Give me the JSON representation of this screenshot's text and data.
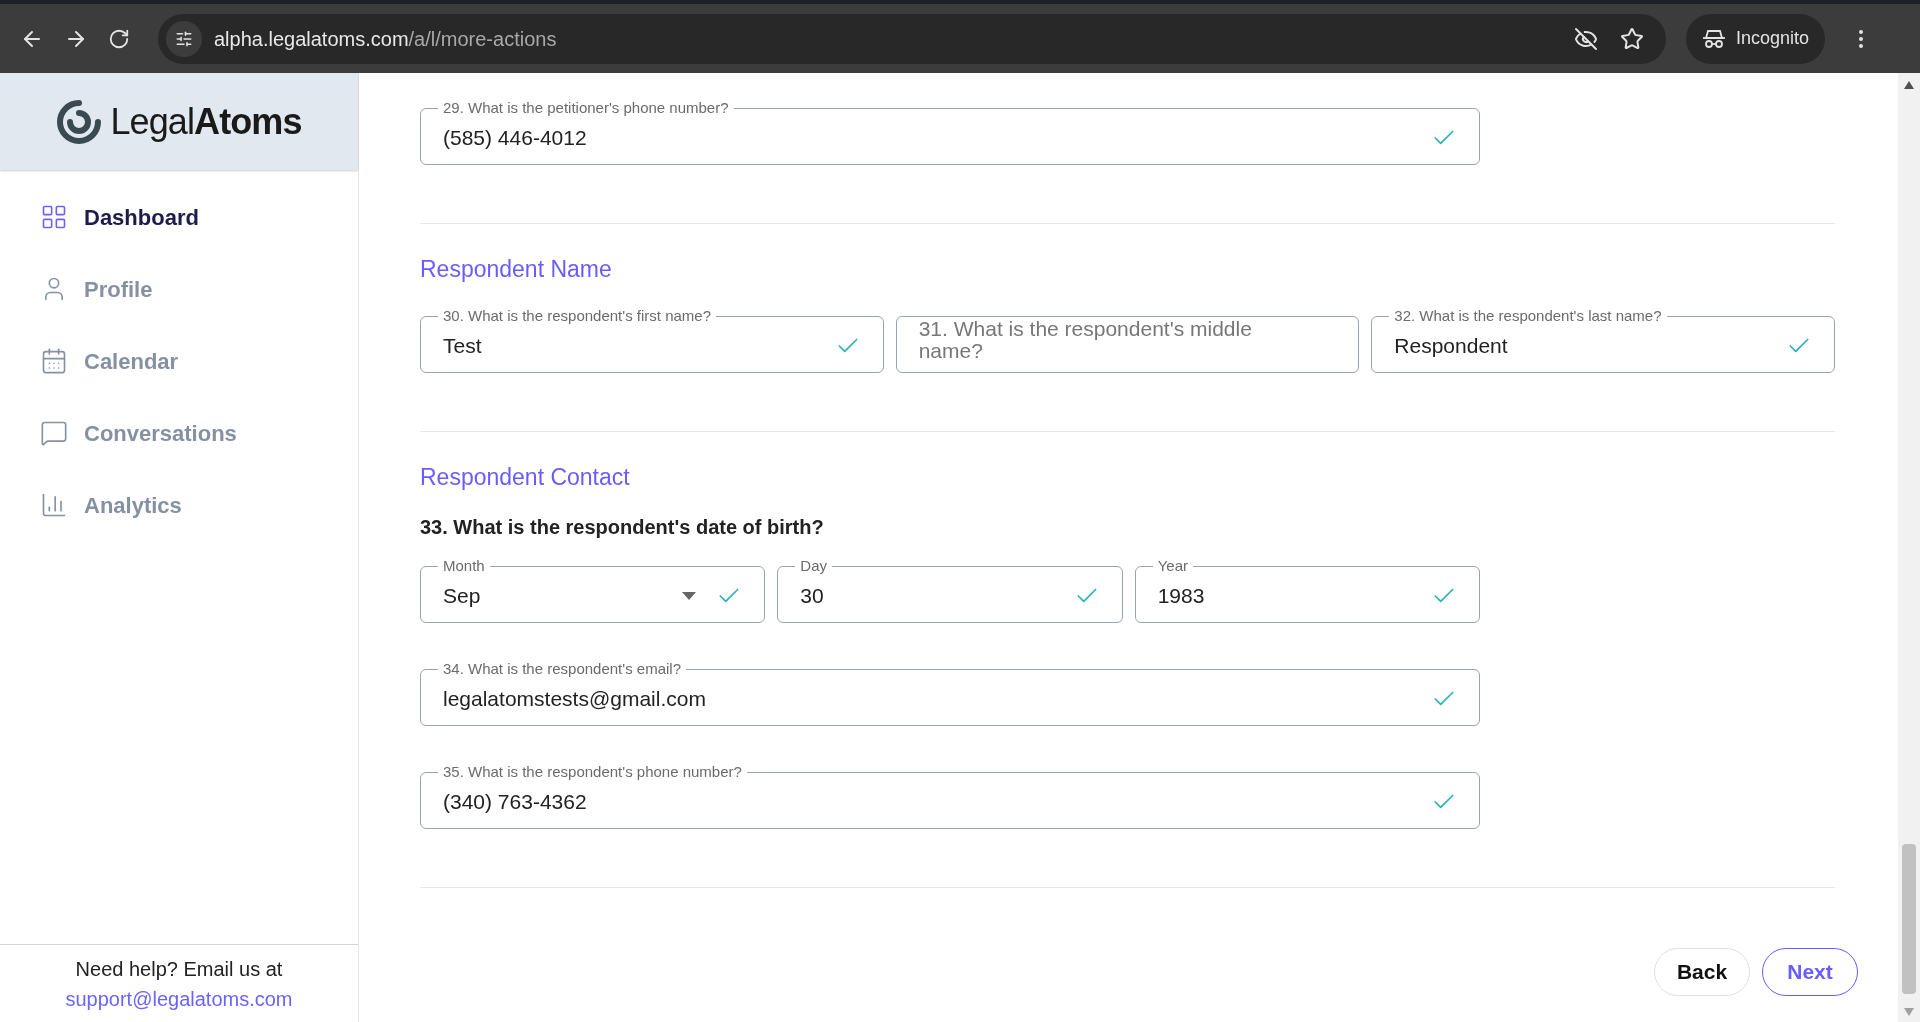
{
  "browser": {
    "url_host": "alpha.legalatoms.com",
    "url_path": "/a/l/more-actions",
    "profile_label": "Incognito"
  },
  "sidebar": {
    "logo": {
      "light": "Legal",
      "bold": "Atoms"
    },
    "items": [
      {
        "label": "Dashboard",
        "selected": true
      },
      {
        "label": "Profile",
        "selected": false
      },
      {
        "label": "Calendar",
        "selected": false
      },
      {
        "label": "Conversations",
        "selected": false
      },
      {
        "label": "Analytics",
        "selected": false
      }
    ],
    "help_text": "Need help? Email us at",
    "help_email": "support@legalatoms.com"
  },
  "sections": [
    {
      "groups": [
        {
          "kind": "standard",
          "fields": [
            {
              "kind": "text",
              "label": "29. What is the petitioner's phone number?",
              "value": "(585) 446-4012",
              "valid": true
            }
          ]
        }
      ]
    },
    {
      "heading": "Respondent Name",
      "groups": [
        {
          "kind": "wide",
          "fields": [
            {
              "kind": "text",
              "label": "30. What is the respondent's first name?",
              "value": "Test",
              "valid": true
            },
            {
              "kind": "text",
              "placeholder": "31. What is the respondent's middle name?",
              "valid": false
            },
            {
              "kind": "text",
              "label": "32. What is the respondent's last name?",
              "value": "Respondent",
              "valid": true
            }
          ]
        }
      ]
    },
    {
      "heading": "Respondent Contact",
      "groups": [
        {
          "kind": "standard",
          "question": "33. What is the respondent's date of birth?",
          "fields": [
            {
              "kind": "select",
              "label": "Month",
              "value": "Sep",
              "valid": true
            },
            {
              "kind": "text",
              "label": "Day",
              "value": "30",
              "valid": true
            },
            {
              "kind": "text",
              "label": "Year",
              "value": "1983",
              "valid": true
            }
          ]
        },
        {
          "kind": "standard",
          "fields": [
            {
              "kind": "text",
              "label": "34. What is the respondent's email?",
              "value": "legalatomstests@gmail.com",
              "valid": true
            }
          ]
        },
        {
          "kind": "standard",
          "fields": [
            {
              "kind": "text",
              "label": "35. What is the respondent's phone number?",
              "value": "(340) 763-4362",
              "valid": true
            }
          ]
        }
      ]
    }
  ],
  "buttons": [
    {
      "label": "Back",
      "kind": "secondary"
    },
    {
      "label": "Next",
      "kind": "primary"
    }
  ]
}
